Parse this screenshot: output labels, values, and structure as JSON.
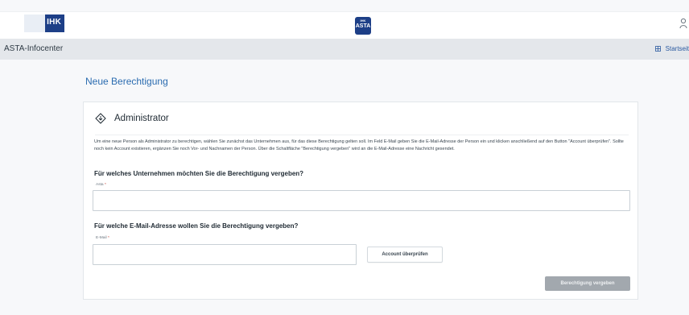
{
  "header": {
    "ihk_logo_text": "IHK",
    "asta_logo_top": "IHK",
    "asta_logo_bottom": "ASTA",
    "user_icon": "user-icon"
  },
  "subbar": {
    "app_title": "ASTA-Infocenter",
    "home_link": "Startseit",
    "home_icon": "grid-icon"
  },
  "page": {
    "title": "Neue Berechtigung"
  },
  "card": {
    "icon": "diamond-icon",
    "title": "Administrator",
    "intro": "Um eine neue Person als Administrator zu berechtigen, wählen Sie zunächst das Unternehmen aus, für das diese Berechtigung gelten soll. Im Feld E-Mail geben Sie die E-Mail-Adresse der Person ein und klicken anschließend auf den Button \"Account überprüfen\". Sollte noch kein Account existieren, ergänzen Sie noch Vor- und Nachnamen der Person. Über die Schaltfläche \"Berechtigung vergeben\" wird an die E-Mail-Adresse eine Nachricht gesendet.",
    "question_company": "Für welches Unternehmen möchten Sie die Berechtigung vergeben?",
    "company_field": {
      "label": "Asta",
      "required_mark": "*",
      "value": ""
    },
    "question_email": "Für welche E-Mail-Adresse wollen Sie die Berechtigung vergeben?",
    "email_field": {
      "label": "E-Mail",
      "required_mark": "*",
      "value": ""
    },
    "check_button": "Account überprüfen",
    "grant_button": "Berechtigung vergeben"
  },
  "colors": {
    "brand_blue": "#1d3f87",
    "link_blue": "#2b6cb0",
    "disabled_button": "#a2a8ae"
  }
}
